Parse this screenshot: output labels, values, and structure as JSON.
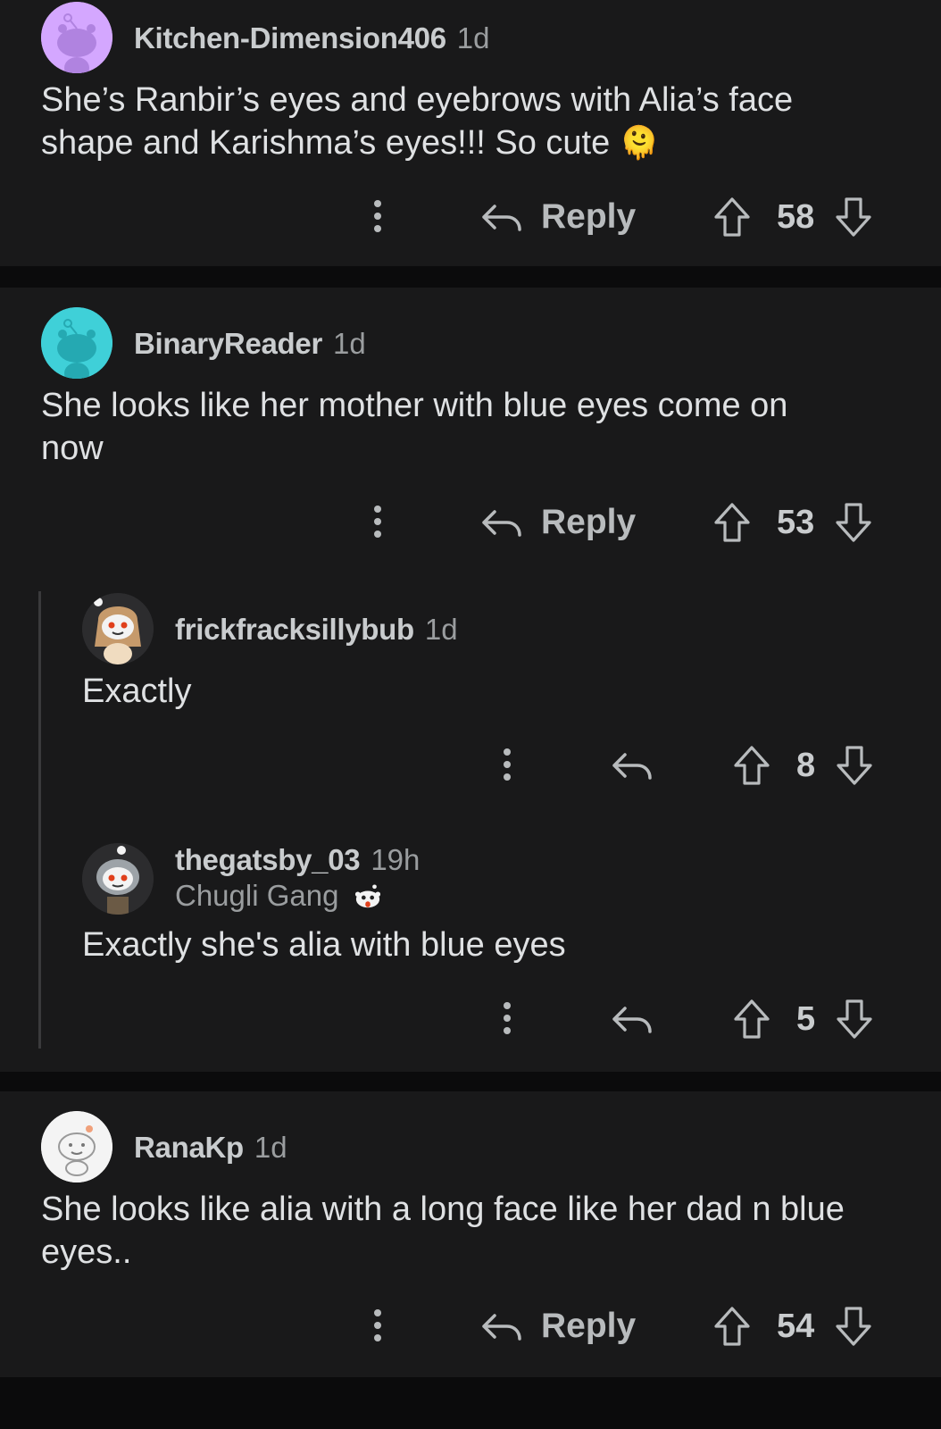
{
  "comments": [
    {
      "username": "Kitchen-Dimension406",
      "time": "1d",
      "text": "She’s Ranbir’s eyes and eyebrows with Alia’s face shape and Karishma’s eyes!!! So cute",
      "emoji": "🫠",
      "reply_label": "Reply",
      "score": "58",
      "avatar_color": "#d4a7ff"
    },
    {
      "username": "BinaryReader",
      "time": "1d",
      "text": "She looks like her mother with blue eyes come on now",
      "reply_label": "Reply",
      "score": "53",
      "avatar_color": "#3fd0d8"
    },
    {
      "username": "frickfracksillybub",
      "time": "1d",
      "text": "Exactly",
      "score": "8"
    },
    {
      "username": "thegatsby_03",
      "time": "19h",
      "flair": "Chugli Gang",
      "text": "Exactly she's alia with blue eyes",
      "score": "5"
    },
    {
      "username": "RanaKp",
      "time": "1d",
      "text": "She looks like alia with a long face like her dad n blue eyes..",
      "reply_label": "Reply",
      "score": "54"
    }
  ],
  "icons": {
    "more": "more-vertical-icon",
    "reply": "reply-arrow-icon",
    "upvote": "upvote-arrow-icon",
    "downvote": "downvote-arrow-icon"
  }
}
